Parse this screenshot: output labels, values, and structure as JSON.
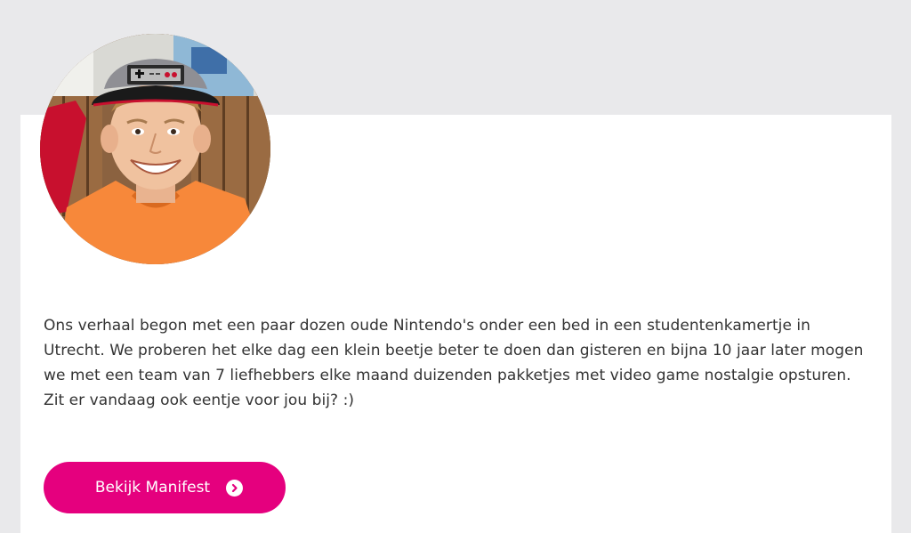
{
  "about": {
    "story": "Ons verhaal begon met een paar dozen oude Nintendo's onder een bed in een studentenkamertje in Utrecht. We proberen het elke dag een klein beetje beter te doen dan gisteren en bijna 10 jaar later mogen we met een team van 7 liefhebbers elke maand duizenden pakketjes met video game nostalgie opsturen. Zit er vandaag ook eentje voor jou bij? :)"
  },
  "cta": {
    "label": "Bekijk Manifest",
    "icon": "chevron-right-circle-icon",
    "color": "#e5007e"
  },
  "colors": {
    "page_background": "#e9e9eb",
    "card_background": "#ffffff",
    "text": "#333333"
  }
}
